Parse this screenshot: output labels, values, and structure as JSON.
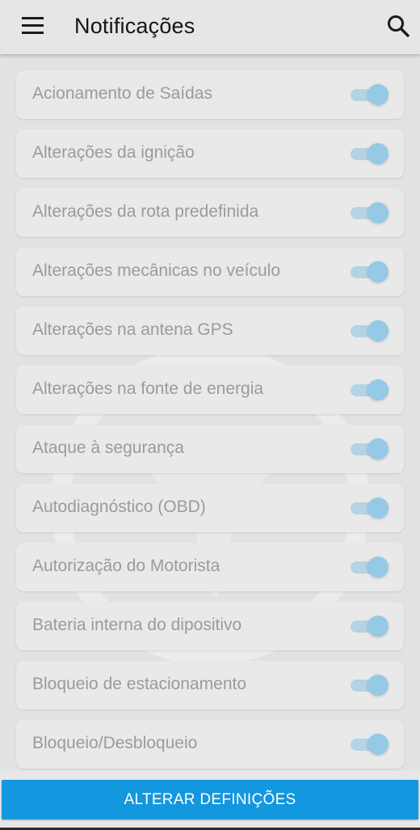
{
  "app_bar": {
    "title": "Notificações",
    "menu_icon": "hamburger-menu-icon",
    "search_icon": "search-icon"
  },
  "notifications": [
    {
      "label": "Acionamento de Saídas",
      "enabled": true
    },
    {
      "label": "Alterações da ignição",
      "enabled": true
    },
    {
      "label": "Alterações da rota predefinida",
      "enabled": true
    },
    {
      "label": "Alterações mecânicas no veículo",
      "enabled": true
    },
    {
      "label": "Alterações na antena GPS",
      "enabled": true
    },
    {
      "label": "Alterações na fonte de energia",
      "enabled": true
    },
    {
      "label": "Ataque à segurança",
      "enabled": true
    },
    {
      "label": "Autodiagnóstico (OBD)",
      "enabled": true
    },
    {
      "label": "Autorização do Motorista",
      "enabled": true
    },
    {
      "label": "Bateria interna do dipositivo",
      "enabled": true
    },
    {
      "label": "Bloqueio de estacionamento",
      "enabled": true
    },
    {
      "label": "Bloqueio/Desbloqueio",
      "enabled": true
    }
  ],
  "footer": {
    "button_label": "ALTERAR DEFINIÇÕES"
  },
  "colors": {
    "accent": "#1397df",
    "toggle_on_thumb": "#95c9e6",
    "toggle_on_track": "#b4d3e4",
    "disabled_text": "#9b9b9b"
  }
}
